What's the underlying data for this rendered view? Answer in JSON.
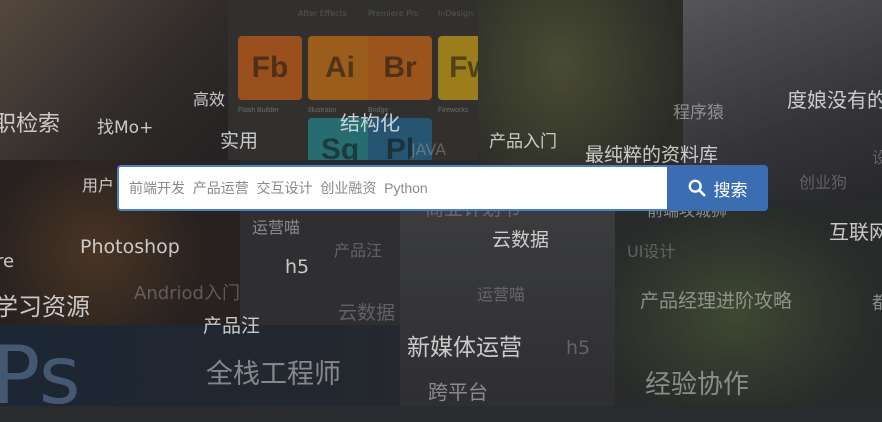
{
  "background_icons": [
    {
      "abbr": "Fb",
      "caption": "Flash Builder",
      "color": "#c7651f"
    },
    {
      "abbr": "Ai",
      "caption": "Illustrator",
      "color": "#c9761c"
    },
    {
      "abbr": "Br",
      "caption": "Bridge",
      "color": "#c86a1c"
    },
    {
      "abbr": "Fw",
      "caption": "Fireworks",
      "color": "#c8a11c"
    },
    {
      "abbr": "Sq",
      "caption": "",
      "color": "#2c8a8f"
    },
    {
      "abbr": "Pl",
      "caption": "",
      "color": "#2c6b8f"
    }
  ],
  "top_captions": [
    "After Effects",
    "Premiere Pro",
    "InDesign"
  ],
  "keywords": [
    {
      "id": "k1",
      "text": "职检索"
    },
    {
      "id": "k2",
      "text": "找Mo+"
    },
    {
      "id": "k3",
      "text": "高效"
    },
    {
      "id": "k4",
      "text": "实用"
    },
    {
      "id": "k5",
      "text": "结构化"
    },
    {
      "id": "k6",
      "text": "JAVA"
    },
    {
      "id": "k7",
      "text": "产品入门"
    },
    {
      "id": "k8",
      "text": "程序猿"
    },
    {
      "id": "k9",
      "text": "度娘没有的"
    },
    {
      "id": "k10",
      "text": "最纯粹的资料库"
    },
    {
      "id": "k11",
      "text": "用户"
    },
    {
      "id": "k12",
      "text": "创业狗"
    },
    {
      "id": "k13",
      "text": "商业计划书"
    },
    {
      "id": "k14",
      "text": "前端攻城狮"
    },
    {
      "id": "k15",
      "text": "运营喵"
    },
    {
      "id": "k16",
      "text": "云数据"
    },
    {
      "id": "k17",
      "text": "互联网"
    },
    {
      "id": "k18",
      "text": "Photoshop"
    },
    {
      "id": "k19",
      "text": "产品汪"
    },
    {
      "id": "k20",
      "text": "UI设计"
    },
    {
      "id": "k21",
      "text": "re"
    },
    {
      "id": "k22",
      "text": "h5"
    },
    {
      "id": "k23",
      "text": "Andriod入门"
    },
    {
      "id": "k24",
      "text": "学习资源"
    },
    {
      "id": "k25",
      "text": "运营喵"
    },
    {
      "id": "k26",
      "text": "产品经理进阶攻略"
    },
    {
      "id": "k27",
      "text": "云数据"
    },
    {
      "id": "k28",
      "text": "产品汪"
    },
    {
      "id": "k29",
      "text": "新媒体运营"
    },
    {
      "id": "k30",
      "text": "h5"
    },
    {
      "id": "k31",
      "text": "全栈工程师"
    },
    {
      "id": "k32",
      "text": "经验协作"
    },
    {
      "id": "k33",
      "text": "跨平台"
    },
    {
      "id": "k34",
      "text": "Ps"
    },
    {
      "id": "k35",
      "text": "都"
    },
    {
      "id": "k36",
      "text": "设"
    }
  ],
  "search": {
    "placeholder": "前端开发  产品运营  交互设计  创业融资  Python",
    "value": "",
    "button_label": "搜索",
    "button_icon": "search-icon",
    "accent": "#3b6db3",
    "border": "#4a80c8"
  }
}
